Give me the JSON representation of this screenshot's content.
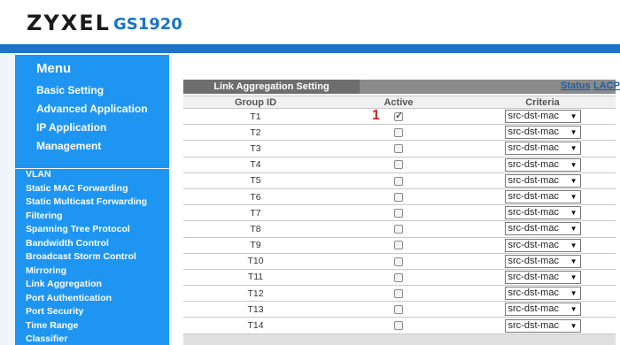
{
  "header": {
    "brand": "ZYXEL",
    "model": "GS1920"
  },
  "menu": {
    "title": "Menu",
    "items": [
      "Basic Setting",
      "Advanced Application",
      "IP Application",
      "Management"
    ],
    "sub_items": [
      "VLAN",
      "Static MAC Forwarding",
      "Static Multicast Forwarding",
      "Filtering",
      "Spanning Tree Protocol",
      "Bandwidth Control",
      "Broadcast Storm Control",
      "Mirroring",
      "Link Aggregation",
      "Port Authentication",
      "Port Security",
      "Time Range",
      "Classifier"
    ]
  },
  "content": {
    "tab_label": "Link Aggregation Setting",
    "links": {
      "status": "Status",
      "lacp": "LACP"
    },
    "columns": {
      "group_id": "Group ID",
      "active": "Active",
      "criteria": "Criteria"
    },
    "marker_text": "1",
    "rows": [
      {
        "group": "T1",
        "active": true,
        "criteria": "src-dst-mac"
      },
      {
        "group": "T2",
        "active": false,
        "criteria": "src-dst-mac"
      },
      {
        "group": "T3",
        "active": false,
        "criteria": "src-dst-mac"
      },
      {
        "group": "T4",
        "active": false,
        "criteria": "src-dst-mac"
      },
      {
        "group": "T5",
        "active": false,
        "criteria": "src-dst-mac"
      },
      {
        "group": "T6",
        "active": false,
        "criteria": "src-dst-mac"
      },
      {
        "group": "T7",
        "active": false,
        "criteria": "src-dst-mac"
      },
      {
        "group": "T8",
        "active": false,
        "criteria": "src-dst-mac"
      },
      {
        "group": "T9",
        "active": false,
        "criteria": "src-dst-mac"
      },
      {
        "group": "T10",
        "active": false,
        "criteria": "src-dst-mac"
      },
      {
        "group": "T11",
        "active": false,
        "criteria": "src-dst-mac"
      },
      {
        "group": "T12",
        "active": false,
        "criteria": "src-dst-mac"
      },
      {
        "group": "T13",
        "active": false,
        "criteria": "src-dst-mac"
      },
      {
        "group": "T14",
        "active": false,
        "criteria": "src-dst-mac"
      }
    ]
  },
  "colors": {
    "brand_blue": "#1e73c8",
    "menu_blue": "#1f95f2",
    "marker_red": "#c7252b"
  },
  "icons": {
    "checkbox": "checkbox-icon",
    "dropdown": "chevron-down-icon"
  }
}
